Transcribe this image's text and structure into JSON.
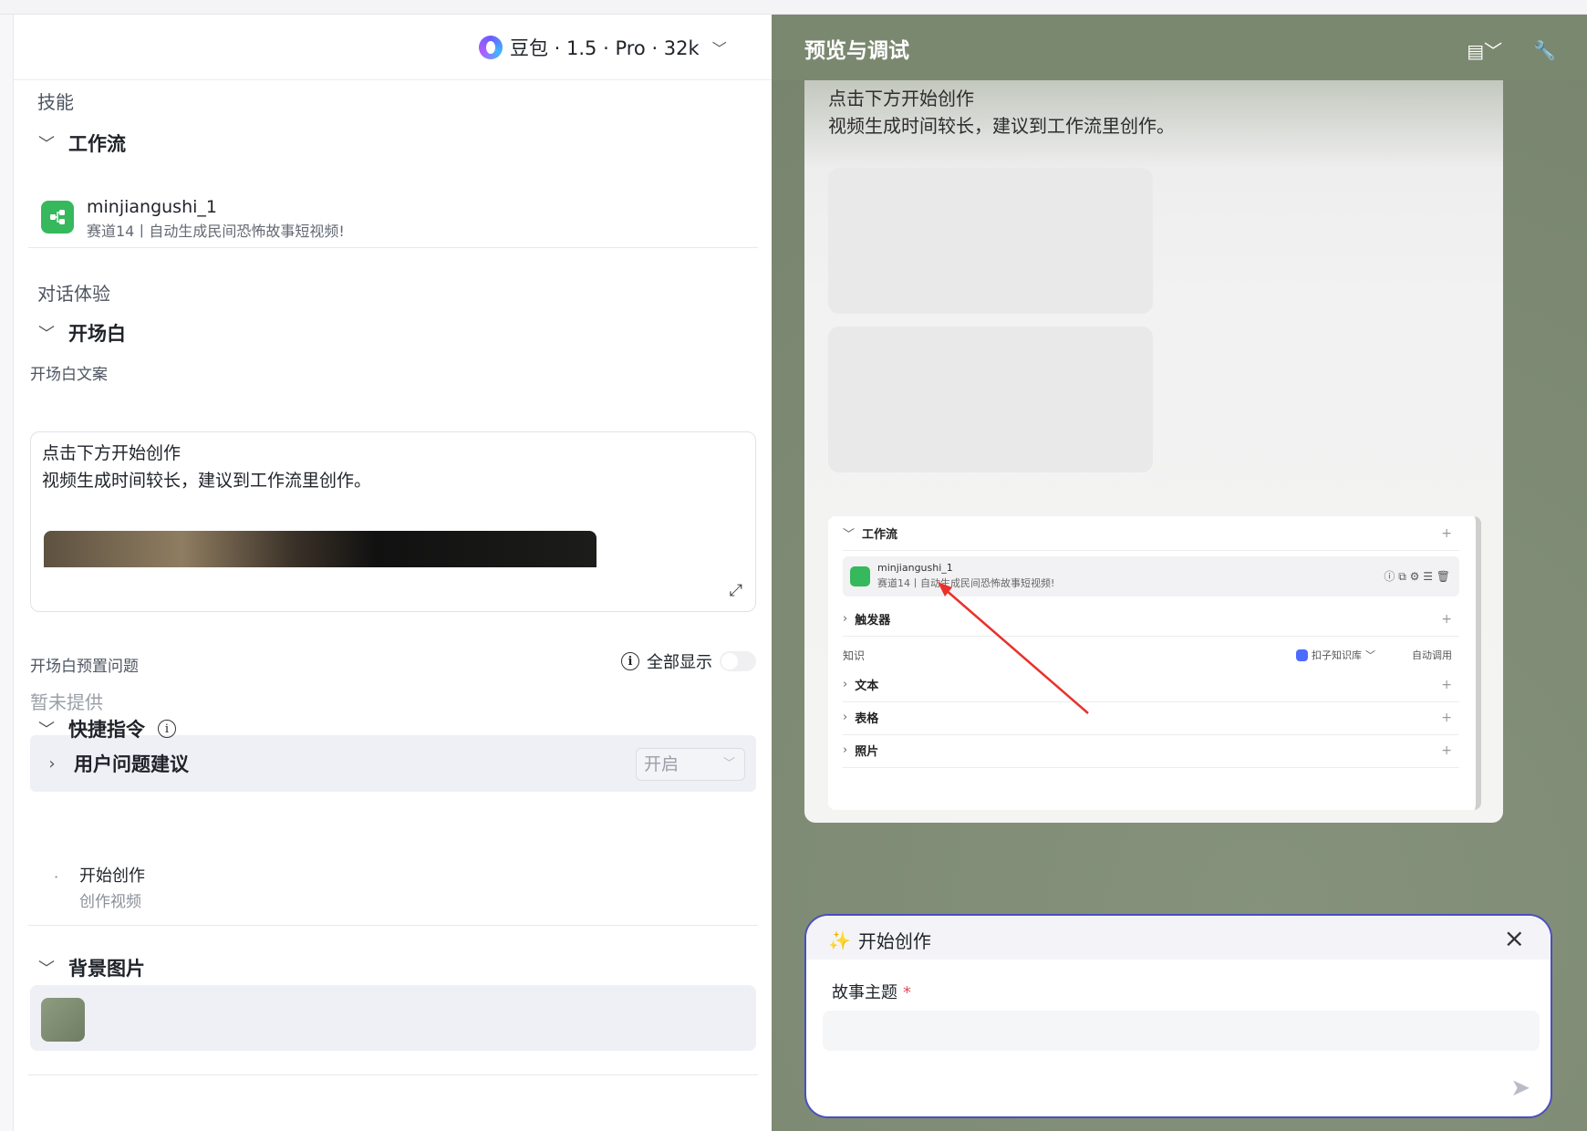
{
  "model": {
    "label": "豆包 · 1.5 · Pro · 32k"
  },
  "skills": {
    "section_title": "技能",
    "workflow_group": "工作流",
    "workflow_item": {
      "name": "minjiangushi_1",
      "desc": "赛道14丨自动生成民间恐怖故事短视频!"
    }
  },
  "dialog_experience": {
    "section_title": "对话体验",
    "opening_group": "开场白",
    "opening_label": "开场白文案",
    "opening_lines": [
      "点击下方开始创作",
      "视频生成时间较长，建议到工作流里创作。"
    ],
    "preset_label": "开场白预置问题",
    "show_all": "全部显示",
    "not_provided": "暂未提供",
    "suggest_group": "用户问题建议",
    "suggest_select": "开启",
    "shortcut_group": "快捷指令",
    "shortcut_item": {
      "title": "开始创作",
      "desc": "创作视频"
    },
    "background_group": "背景图片"
  },
  "preview": {
    "title": "预览与调试",
    "chat_lines": [
      "点击下方开始创作",
      "视频生成时间较长，建议到工作流里创作。"
    ],
    "screenshot": {
      "workflow": "工作流",
      "wf_name": "minjiangushi_1",
      "wf_desc": "赛道14丨自动生成民间恐怖故事短视频!",
      "trigger": "触发器",
      "knowledge": "知识",
      "kb_label": "扣子知识库",
      "auto_label": "自动调用",
      "text": "文本",
      "table": "表格",
      "photo": "照片"
    }
  },
  "dialog": {
    "title": "开始创作",
    "field_label": "故事主题",
    "required_mark": "*"
  },
  "colors": {
    "accent": "#4a4fbf",
    "workflow_green": "#36b85c",
    "preview_bg": "#7f8c74"
  }
}
